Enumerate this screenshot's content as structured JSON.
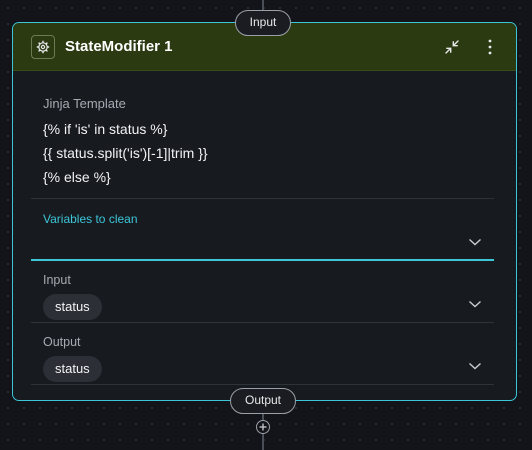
{
  "ports": {
    "input_label": "Input",
    "output_label": "Output"
  },
  "node": {
    "title": "StateModifier 1",
    "icon": "gear-icon",
    "accent_color": "#3cc6d8",
    "header_color": "#2c3a12"
  },
  "template": {
    "label": "Jinja Template",
    "lines": [
      "{% if 'is' in status %}",
      "{{ status.split('is')[-1]|trim }}",
      "{% else %}"
    ]
  },
  "variables": {
    "label": "Variables to clean",
    "value": ""
  },
  "input": {
    "label": "Input",
    "value": "status"
  },
  "output": {
    "label": "Output",
    "value": "status"
  }
}
